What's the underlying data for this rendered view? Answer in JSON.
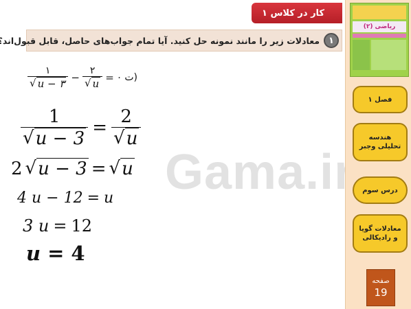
{
  "header": {
    "title": "کار در کلاس ۱"
  },
  "question": {
    "number": "۱",
    "text": "معادلات زیر را مانند نمونه حل کنید. آیا تمام جواب‌های حاصل، قابل قبول‌اند؟"
  },
  "problem": {
    "label": "ت)",
    "numerator_left": "۱",
    "radicand_left": "u − ۳",
    "minus": "−",
    "numerator_right": "۲",
    "radicand_right": "u",
    "equals": "=",
    "zero": "۰"
  },
  "steps": {
    "s1": {
      "num_left": "1",
      "radicand_left": "u − 3",
      "equals": "=",
      "num_right": "2",
      "radicand_right": "u"
    },
    "s2": {
      "coef": "2",
      "radicand_left": "u − 3",
      "equals": "=",
      "radicand_right": "u"
    },
    "s3": {
      "lhs": "4 u − 12",
      "equals": "=",
      "rhs": "u"
    },
    "s4": {
      "lhs": "3 u",
      "equals": "=",
      "rhs": "12"
    },
    "s5": {
      "lhs": "u",
      "equals": "=",
      "rhs": "4"
    }
  },
  "watermark": "Gama.ir",
  "sidebar": {
    "thumb_title": "ریاضی (۲)",
    "chapter": "فصل ۱",
    "section": "هندسه تحلیلی وجبر",
    "lesson": "درس سوم",
    "topic": "معادلات گویا و رادیکالی",
    "page_label": "صفحه",
    "page_number": "19"
  },
  "colors": {
    "title_bg": "#c62a31",
    "sidebar_bg": "#fbe1c4",
    "pill_bg": "#f6c92a",
    "page_bg": "#c0561b"
  }
}
